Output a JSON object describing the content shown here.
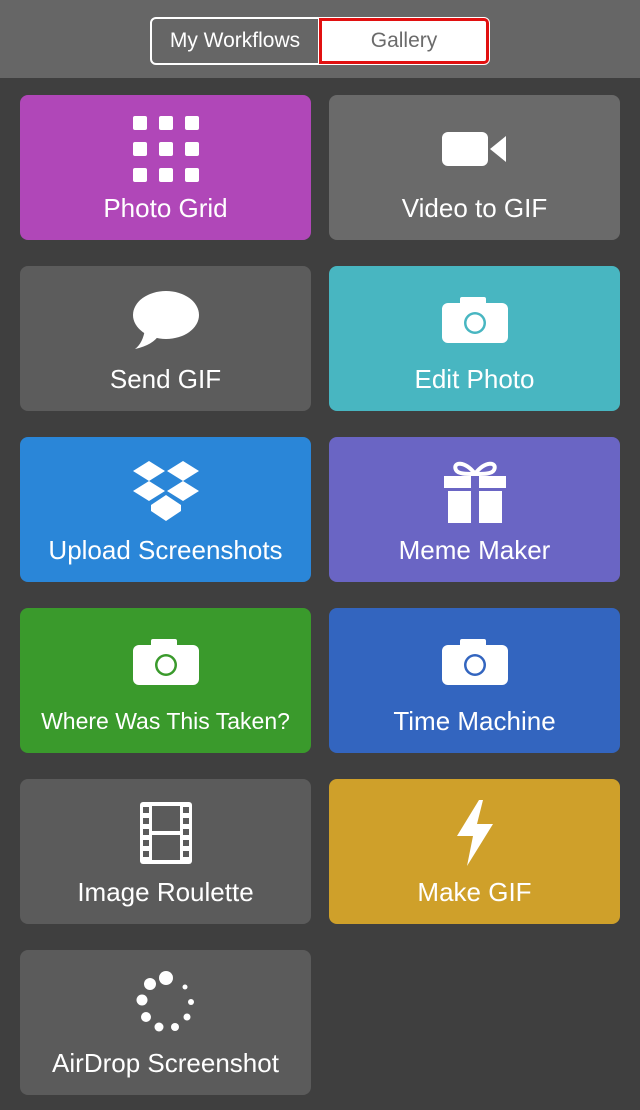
{
  "segmented": {
    "left_label": "My Workflows",
    "right_label": "Gallery"
  },
  "tiles": [
    {
      "label": "Photo Grid",
      "icon": "grid-icon",
      "color": "#b047b8"
    },
    {
      "label": "Video to GIF",
      "icon": "video-camera-icon",
      "color": "#6a6a6a"
    },
    {
      "label": "Send GIF",
      "icon": "speech-bubble-icon",
      "color": "#5c5c5c"
    },
    {
      "label": "Edit Photo",
      "icon": "camera-icon",
      "color": "#48b6c1"
    },
    {
      "label": "Upload Screenshots",
      "icon": "dropbox-icon",
      "color": "#2a86d8"
    },
    {
      "label": "Meme Maker",
      "icon": "gift-icon",
      "color": "#6a65c4"
    },
    {
      "label": "Where Was This Taken?",
      "icon": "camera-icon",
      "color": "#3a9a2c"
    },
    {
      "label": "Time Machine",
      "icon": "camera-icon",
      "color": "#3365bf"
    },
    {
      "label": "Image Roulette",
      "icon": "film-strip-icon",
      "color": "#5b5b5b"
    },
    {
      "label": "Make GIF",
      "icon": "lightning-bolt-icon",
      "color": "#cfa02a"
    },
    {
      "label": "AirDrop Screenshot",
      "icon": "spinner-icon",
      "color": "#5b5b5b"
    }
  ]
}
